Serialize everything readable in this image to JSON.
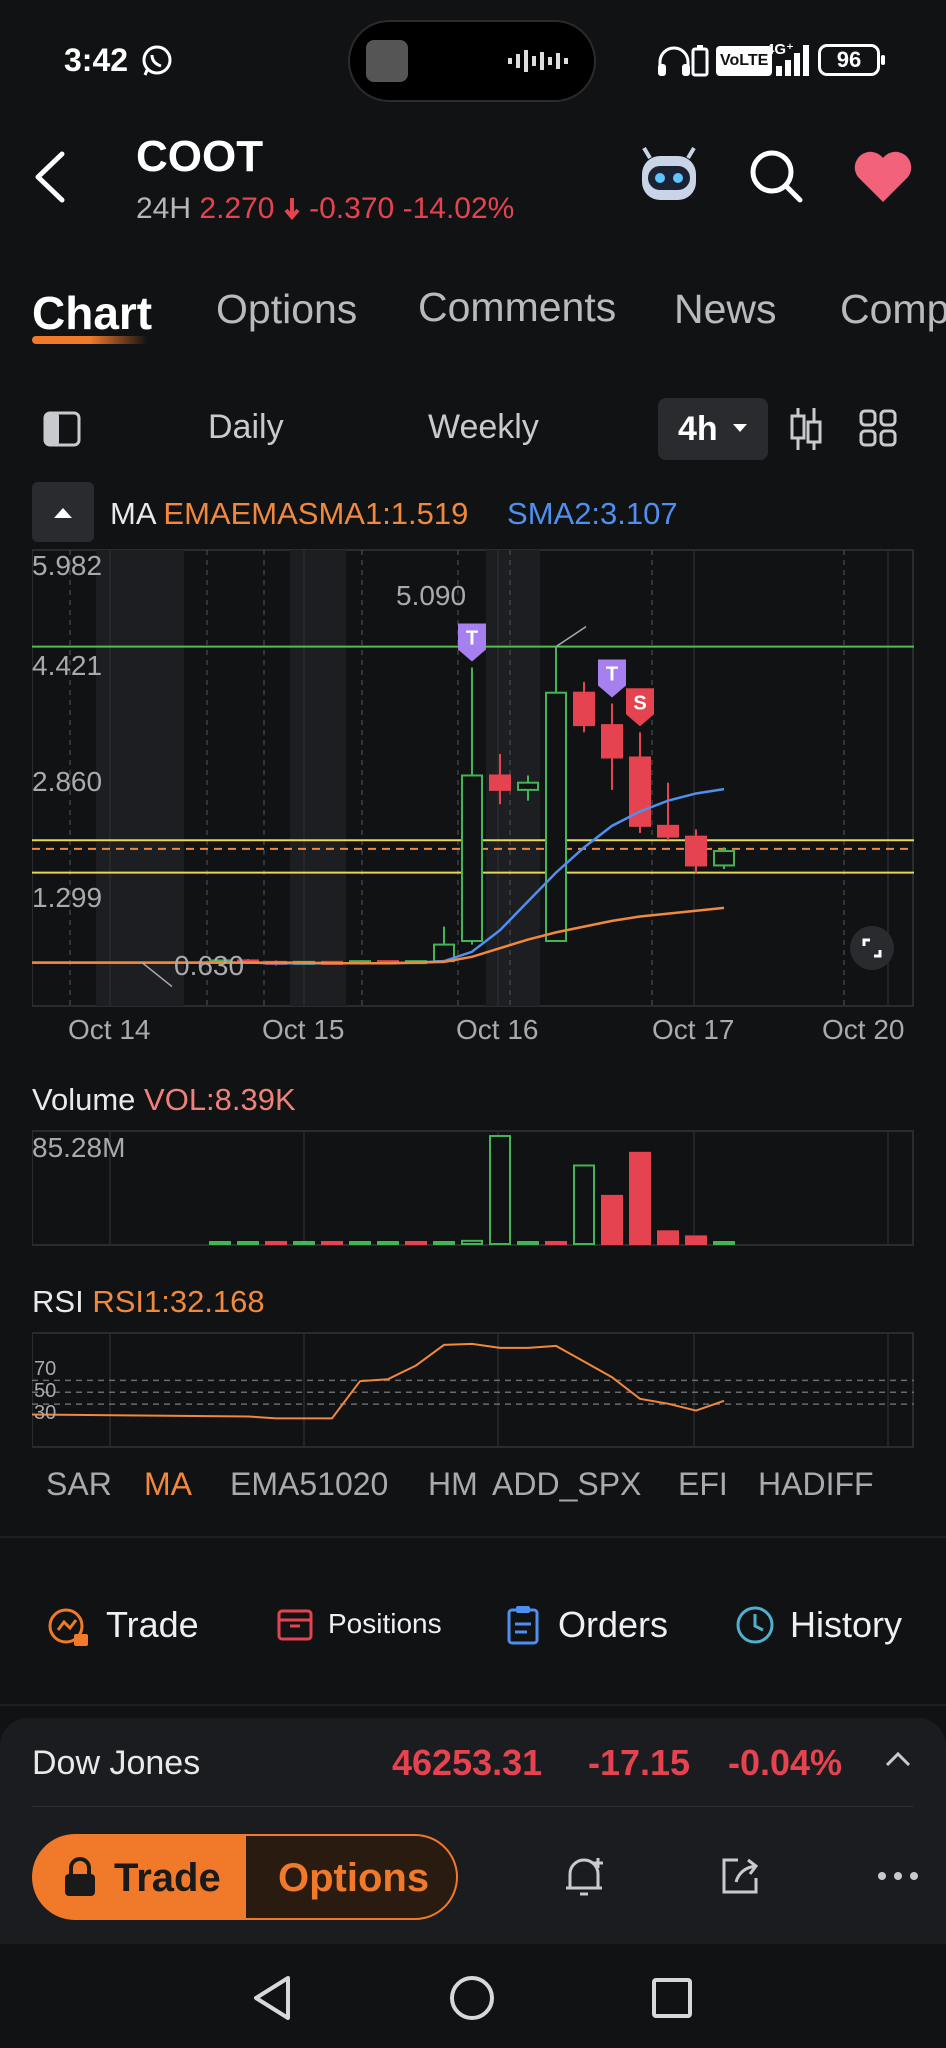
{
  "status_bar": {
    "time": "3:42",
    "network": "4G⁺",
    "volte": "VoLTE",
    "battery": "96"
  },
  "header": {
    "ticker": "COOT",
    "period_label": "24H",
    "price": "2.270",
    "change": "-0.370",
    "change_pct": "-14.02%"
  },
  "tabs": [
    {
      "label": "Chart"
    },
    {
      "label": "Options"
    },
    {
      "label": "Comments"
    },
    {
      "label": "News"
    },
    {
      "label": "Comp"
    }
  ],
  "toolbar": {
    "daily": "Daily",
    "weekly": "Weekly",
    "interval": "4h"
  },
  "ma_legend": {
    "label": "MA",
    "ema": "EMAEMASMA1:1.519",
    "sma2": "SMA2:3.107"
  },
  "chart_data": [
    {
      "type": "candlestick",
      "y_ticks": [
        "5.982",
        "4.421",
        "2.860",
        "1.299"
      ],
      "ylim": [
        0.18,
        6.35
      ],
      "x_ticks": [
        "Oct 14",
        "Oct 15",
        "Oct 16",
        "Oct 17",
        "Oct 20"
      ],
      "annotations": {
        "high": "5.090",
        "low": "0.630"
      },
      "candles": [
        {
          "o": 0.72,
          "h": 0.74,
          "l": 0.7,
          "c": 0.73
        },
        {
          "o": 0.73,
          "h": 0.75,
          "l": 0.7,
          "c": 0.71
        },
        {
          "o": 0.71,
          "h": 0.73,
          "l": 0.66,
          "c": 0.7
        },
        {
          "o": 0.7,
          "h": 0.72,
          "l": 0.67,
          "c": 0.71
        },
        {
          "o": 0.71,
          "h": 0.72,
          "l": 0.68,
          "c": 0.7
        },
        {
          "o": 0.7,
          "h": 0.73,
          "l": 0.69,
          "c": 0.72
        },
        {
          "o": 0.72,
          "h": 0.73,
          "l": 0.7,
          "c": 0.71
        },
        {
          "o": 0.71,
          "h": 0.72,
          "l": 0.69,
          "c": 0.72
        },
        {
          "o": 0.72,
          "h": 1.2,
          "l": 0.7,
          "c": 0.95
        },
        {
          "o": 1.0,
          "h": 4.8,
          "l": 0.95,
          "c": 3.3
        },
        {
          "o": 3.3,
          "h": 3.6,
          "l": 2.9,
          "c": 3.1
        },
        {
          "o": 3.1,
          "h": 3.3,
          "l": 2.95,
          "c": 3.2
        },
        {
          "o": 1.0,
          "h": 5.09,
          "l": 1.0,
          "c": 4.45
        },
        {
          "o": 4.45,
          "h": 4.6,
          "l": 3.9,
          "c": 4.0
        },
        {
          "o": 4.0,
          "h": 4.3,
          "l": 3.1,
          "c": 3.55
        },
        {
          "o": 3.55,
          "h": 3.9,
          "l": 2.5,
          "c": 2.6
        },
        {
          "o": 2.6,
          "h": 3.2,
          "l": 2.4,
          "c": 2.45
        },
        {
          "o": 2.45,
          "h": 2.55,
          "l": 1.95,
          "c": 2.05
        },
        {
          "o": 2.05,
          "h": 2.3,
          "l": 2.0,
          "c": 2.25
        }
      ],
      "sma_line": [
        0.7,
        0.7,
        0.69,
        0.69,
        0.69,
        0.69,
        0.69,
        0.7,
        0.72,
        0.85,
        1.15,
        1.55,
        1.95,
        2.3,
        2.6,
        2.8,
        2.95,
        3.05,
        3.11
      ],
      "ema_line": [
        0.7,
        0.7,
        0.7,
        0.7,
        0.69,
        0.69,
        0.69,
        0.7,
        0.71,
        0.78,
        0.9,
        1.02,
        1.12,
        1.2,
        1.28,
        1.34,
        1.38,
        1.42,
        1.46
      ],
      "h_lines": [
        {
          "value": 5.09,
          "color": "#4fbf4f"
        },
        {
          "value": 2.4,
          "color": "#e6d65a"
        },
        {
          "value": 2.28,
          "color": "#f0883e",
          "dashed": true
        },
        {
          "value": 1.95,
          "color": "#e6d65a"
        }
      ],
      "markers": [
        {
          "candle": 9,
          "label": "T",
          "color": "#a680ee"
        },
        {
          "candle": 14,
          "label": "T",
          "color": "#a680ee"
        },
        {
          "candle": 15,
          "label": "S",
          "color": "#e5434f"
        }
      ]
    },
    {
      "type": "bar",
      "label": "Volume",
      "vol_label": "VOL:8.39K",
      "max_label": "85.28M",
      "ylim": [
        0,
        85.28
      ],
      "values": [
        0.3,
        0.3,
        0.2,
        0.3,
        0.3,
        0.2,
        1.0,
        0.5,
        1.5,
        2.5,
        85.28,
        0.8,
        0.5,
        62.0,
        38.0,
        72.0,
        10.0,
        6.0,
        0.8
      ],
      "up": [
        true,
        true,
        false,
        true,
        false,
        true,
        true,
        false,
        true,
        true,
        true,
        true,
        false,
        true,
        false,
        false,
        false,
        false,
        true
      ]
    },
    {
      "type": "line",
      "label": "RSI",
      "rsi_label": "RSI1:32.168",
      "y_ticks": [
        "70",
        "50",
        "30"
      ],
      "ylim": [
        0,
        100
      ],
      "values": [
        24,
        22,
        20,
        20,
        20,
        58,
        60,
        74,
        95,
        96,
        92,
        92,
        94,
        78,
        62,
        40,
        35,
        28,
        38
      ]
    }
  ],
  "indicators": [
    "SAR",
    "MA",
    "EMA51020",
    "HM",
    "ADD_SPX",
    "EFI",
    "HADIFF"
  ],
  "trade_row": {
    "trade": "Trade",
    "positions": "Positions",
    "orders": "Orders",
    "history": "History"
  },
  "market": {
    "name": "Dow Jones",
    "value": "46253.31",
    "change": "-17.15",
    "change_pct": "-0.04%"
  },
  "action_bar": {
    "trade": "Trade",
    "options": "Options"
  }
}
